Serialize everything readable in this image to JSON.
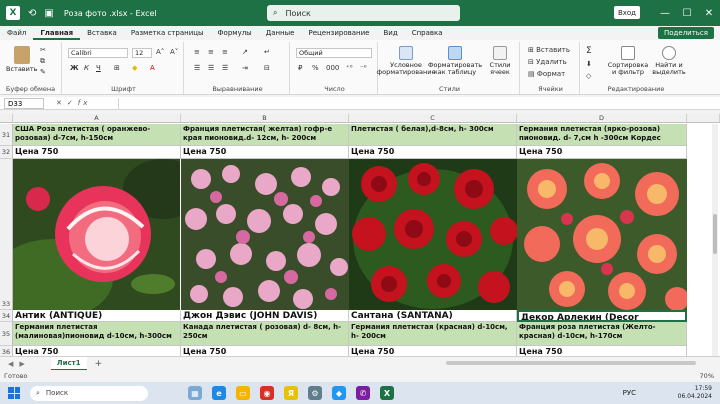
{
  "window": {
    "title": "Роза фото .xlsx  -  Excel",
    "search_placeholder": "Поиск",
    "signin_label": "Вход",
    "minimize": "—",
    "maximize": "☐",
    "close": "✕"
  },
  "menu": {
    "items": [
      "Файл",
      "Главная",
      "Вставка",
      "Разметка страницы",
      "Формулы",
      "Данные",
      "Рецензирование",
      "Вид",
      "Справка"
    ],
    "active": "Главная",
    "share_label": "Поделиться"
  },
  "ribbon": {
    "paste_label": "Вставить",
    "clipboard_group": "Буфер обмена",
    "font_name": "Calibri",
    "font_size": "12",
    "font_group": "Шрифт",
    "bold": "Ж",
    "italic": "К",
    "underline": "Ч",
    "align_group": "Выравнивание",
    "number_format": "Общий",
    "number_group": "Число",
    "cond_format": "Условное форматирование",
    "format_as_table": "Форматировать как таблицу",
    "cell_styles": "Стили ячеек",
    "styles_group": "Стили",
    "insert_label": "Вставить",
    "delete_label": "Удалить",
    "format_label": "Формат",
    "cells_group": "Ячейки",
    "sort_filter": "Сортировка и фильтр",
    "find_select": "Найти и выделить",
    "editing_group": "Редактирование"
  },
  "formula_bar": {
    "name_box": "D33",
    "fx": "fx",
    "value": ""
  },
  "grid": {
    "columns": [
      "A",
      "B",
      "C",
      "D"
    ],
    "rows": {
      "r31": [
        "США Роза плетистая ( оранжево-розовая) d-7см, h-150см",
        "Франция плетистая( желтая) гофр-е края пионовид.d- 12см, h- 200см",
        "Плетистая ( белая),d-8см, h- 300см",
        "Германия  плетистая (ярко-розова) пионовид. d- 7,см  h -300см Кордес"
      ],
      "r32": [
        "Цена  750",
        "Цена  750",
        "Цена  750",
        "Цена  750"
      ],
      "r34": [
        "Антик (ANTIQUE)",
        "Джон Дэвис (JOHN DAVIS)",
        "Сантана (SANTANA)",
        "Декор Арлекин (Decor Arlequin)"
      ],
      "r35": [
        "Германия плетистая (малиновая)пионовид d-10см, h-300см",
        "Канада плетистая ( розовая) d- 8см, h- 250см",
        "Германия плетистая (красная) d-10см, h- 200см",
        "Франция роза плетистая (Желто-красная) d-10см, h-170см"
      ],
      "r36": [
        "Цена 750",
        "Цена 750",
        "Цена 750",
        "Цена 750"
      ]
    },
    "row_numbers": [
      "31",
      "32",
      "33",
      "34",
      "35",
      "36"
    ],
    "photos": [
      "rose-photo-antique",
      "rose-photo-john-davis",
      "rose-photo-santana",
      "rose-photo-decor-arlequin"
    ]
  },
  "sheets": {
    "tabs": [
      "Лист1"
    ],
    "add": "+"
  },
  "status": {
    "ready": "Готово",
    "zoom": "70%"
  },
  "taskbar": {
    "search_placeholder": "Поиск",
    "lang": "РУС",
    "time": "17:59",
    "date": "06.04.2024"
  },
  "colors": {
    "excel_green": "#1e7145",
    "label_green": "#c5e0b3"
  }
}
